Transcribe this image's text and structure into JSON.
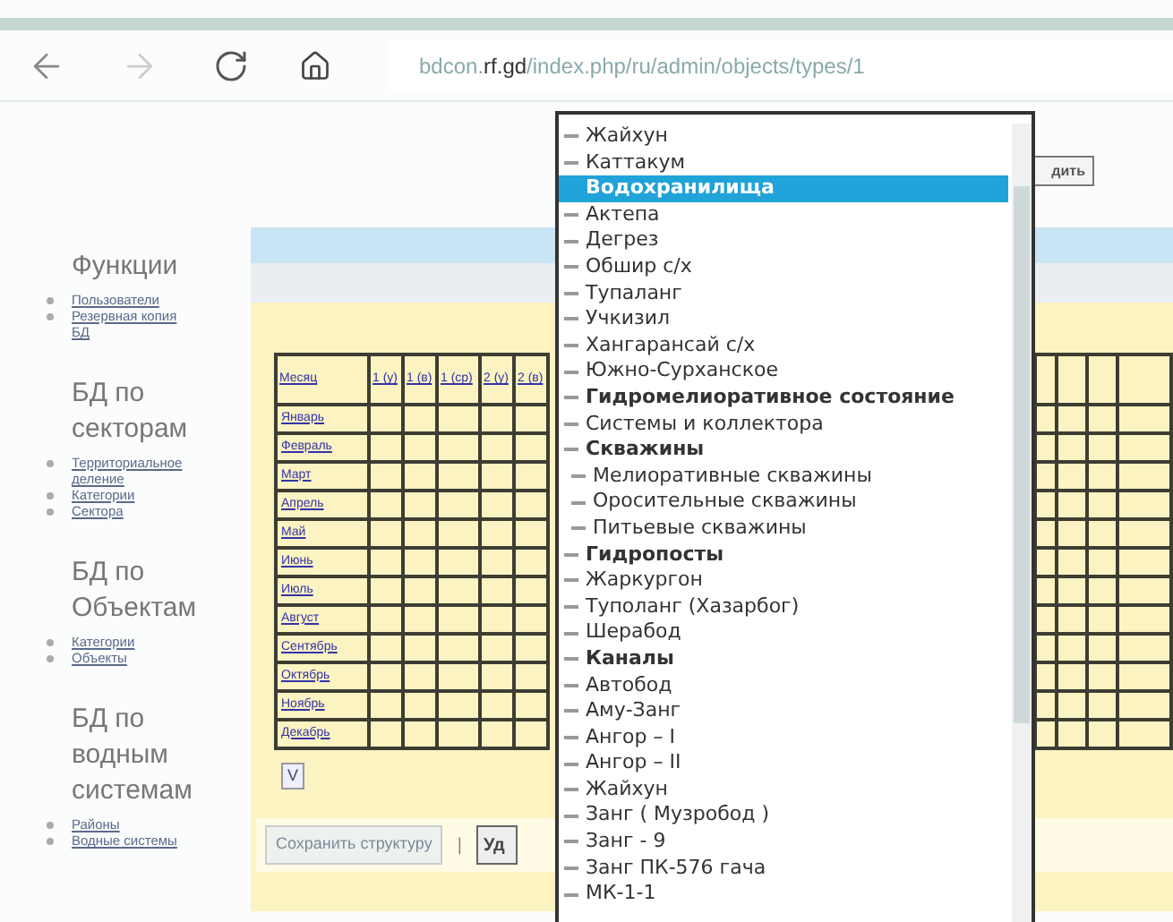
{
  "browser": {
    "url_host": "bdcon.",
    "url_domain": "rf.gd",
    "url_path": "/index.php/ru/admin/objects/types/1"
  },
  "sidebar": [
    {
      "heading": "Функции",
      "links": [
        "Пользователи",
        "Резервная копия БД"
      ]
    },
    {
      "heading": "БД по секторам",
      "links": [
        "Территориальное деление",
        "Категории",
        "Сектора"
      ]
    },
    {
      "heading": "БД по Объектам",
      "links": [
        "Категории",
        "Объекты"
      ]
    },
    {
      "heading": "БД по водным системам",
      "links": [
        "Районы",
        "Водные системы"
      ]
    }
  ],
  "top_button": "дить",
  "table": {
    "columns": [
      "Месяц",
      "1 (у)",
      "1 (в)",
      "1 (ср)",
      "2 (у)",
      "2 (в)"
    ],
    "rows": [
      "Январь",
      "Февраль",
      "Март",
      "Апрель",
      "Май",
      "Июнь",
      "Июль",
      "Август",
      "Сентябрь",
      "Октябрь",
      "Ноябрь",
      "Декабрь"
    ]
  },
  "toggle_button": "V",
  "save_button": "Сохранить структуру",
  "separator": "|",
  "delete_button": "Уд",
  "dropdown": [
    {
      "label": "Жайхун",
      "kind": "item",
      "selected": false
    },
    {
      "label": "Каттакум",
      "kind": "item",
      "selected": false
    },
    {
      "label": "Водохранилища",
      "kind": "group",
      "selected": true
    },
    {
      "label": "Актепа",
      "kind": "item",
      "selected": false
    },
    {
      "label": "Дегрез",
      "kind": "item",
      "selected": false
    },
    {
      "label": "Обшир с/х",
      "kind": "item",
      "selected": false
    },
    {
      "label": "Тупаланг",
      "kind": "item",
      "selected": false
    },
    {
      "label": "Учкизил",
      "kind": "item",
      "selected": false
    },
    {
      "label": "Хангарансай с/х",
      "kind": "item",
      "selected": false
    },
    {
      "label": "Южно-Сурханское",
      "kind": "item",
      "selected": false
    },
    {
      "label": "Гидромелиоративное состояние",
      "kind": "group",
      "selected": false
    },
    {
      "label": "Системы и коллектора",
      "kind": "item",
      "selected": false
    },
    {
      "label": "Скважины",
      "kind": "group",
      "selected": false,
      "children": [
        {
          "label": "Мелиоративные скважины",
          "kind": "item",
          "selected": false
        },
        {
          "label": "Оросительные скважины",
          "kind": "item",
          "selected": false
        },
        {
          "label": "Питьевые скважины",
          "kind": "item",
          "selected": false
        }
      ]
    },
    {
      "label": "Гидропосты",
      "kind": "group",
      "selected": false
    },
    {
      "label": "Жаркургон",
      "kind": "item",
      "selected": false
    },
    {
      "label": "Туполанг (Хазарбог)",
      "kind": "item",
      "selected": false
    },
    {
      "label": "Шерабод",
      "kind": "item",
      "selected": false
    },
    {
      "label": "Каналы",
      "kind": "group",
      "selected": false
    },
    {
      "label": "Автобод",
      "kind": "item",
      "selected": false
    },
    {
      "label": "Аму-Занг",
      "kind": "item",
      "selected": false
    },
    {
      "label": "Ангор – I",
      "kind": "item",
      "selected": false
    },
    {
      "label": "Ангор – II",
      "kind": "item",
      "selected": false
    },
    {
      "label": "Жайхун",
      "kind": "item",
      "selected": false
    },
    {
      "label": "Занг ( Музробод )",
      "kind": "item",
      "selected": false
    },
    {
      "label": "Занг - 9",
      "kind": "item",
      "selected": false
    },
    {
      "label": "Занг ПК-576 гача",
      "kind": "item",
      "selected": false
    },
    {
      "label": "МК-1-1",
      "kind": "item",
      "selected": false
    }
  ]
}
